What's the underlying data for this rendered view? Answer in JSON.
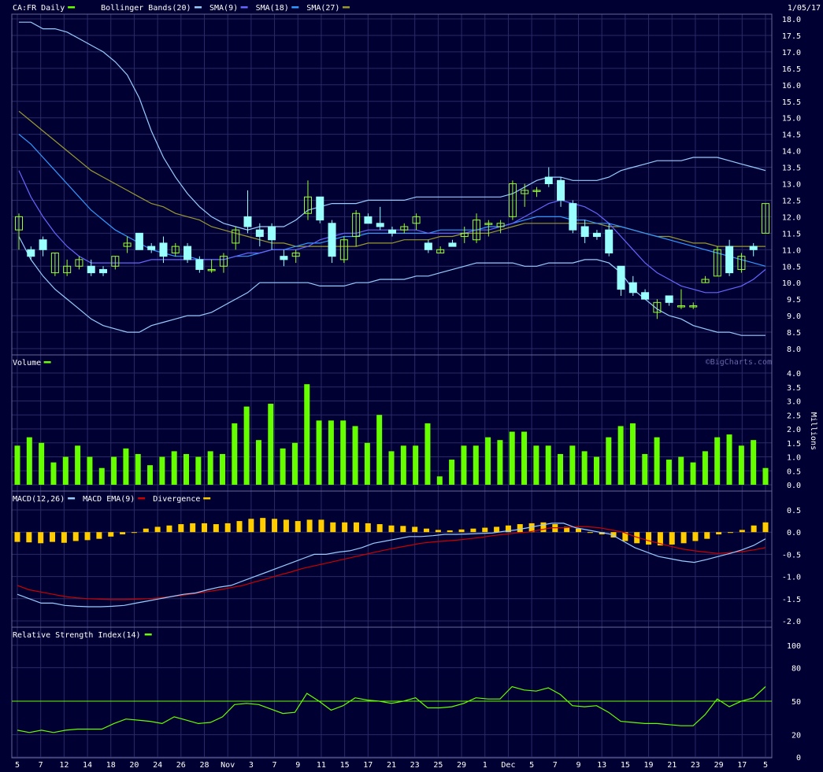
{
  "header": {
    "symbol_label": "CA:FR Daily",
    "date": "1/05/17",
    "watermark": "©BigCharts.com"
  },
  "colors": {
    "background": "#000033",
    "grid": "#2a2a66",
    "candle_up": "#99ff33",
    "candle_down": "#99ffff",
    "bollinger": "#99ccff",
    "sma9": "#6666ff",
    "sma18": "#3399ff",
    "sma27": "#999933",
    "volume": "#66ff00",
    "macd": "#99ccff",
    "macd_ema": "#cc0000",
    "divergence": "#ffcc00",
    "rsi": "#66ff00",
    "rsi_line": "#66ff00"
  },
  "legends": {
    "price": [
      {
        "label": "CA:FR Daily",
        "color": "#66ff00"
      },
      {
        "label": "Bollinger Bands(20)",
        "color": "#99ccff"
      },
      {
        "label": "SMA(9)",
        "color": "#6666ff"
      },
      {
        "label": "SMA(18)",
        "color": "#3399ff"
      },
      {
        "label": "SMA(27)",
        "color": "#999933"
      }
    ],
    "volume": [
      {
        "label": "Volume",
        "color": "#66ff00"
      }
    ],
    "macd": [
      {
        "label": "MACD(12,26)",
        "color": "#99ccff"
      },
      {
        "label": "MACD EMA(9)",
        "color": "#cc0000"
      },
      {
        "label": "Divergence",
        "color": "#ffcc00"
      }
    ],
    "rsi": [
      {
        "label": "Relative Strength Index(14)",
        "color": "#66ff00"
      }
    ]
  },
  "x_axis_labels": [
    "5",
    "7",
    "12",
    "14",
    "18",
    "20",
    "24",
    "26",
    "28",
    "Nov",
    "3",
    "7",
    "9",
    "11",
    "15",
    "17",
    "21",
    "23",
    "25",
    "29",
    "1",
    "Dec",
    "5",
    "7",
    "9",
    "13",
    "15",
    "19",
    "21",
    "23",
    "29",
    "17",
    "5"
  ],
  "chart_data": [
    {
      "type": "candlestick",
      "panel": "price",
      "ylim": [
        8.0,
        18.0
      ],
      "y_ticks": [
        "8.0",
        "8.5",
        "9.0",
        "9.5",
        "10.0",
        "10.5",
        "11.0",
        "11.5",
        "12.0",
        "12.5",
        "13.0",
        "13.5",
        "14.0",
        "14.5",
        "15.0",
        "15.5",
        "16.0",
        "16.5",
        "17.0",
        "17.5",
        "18.0"
      ],
      "candles": [
        {
          "o": 11.6,
          "h": 12.1,
          "l": 11.0,
          "c": 12.0
        },
        {
          "o": 11.0,
          "h": 11.1,
          "l": 10.7,
          "c": 10.8
        },
        {
          "o": 11.3,
          "h": 11.4,
          "l": 10.8,
          "c": 11.0
        },
        {
          "o": 10.3,
          "h": 10.9,
          "l": 10.2,
          "c": 10.9
        },
        {
          "o": 10.3,
          "h": 10.7,
          "l": 10.2,
          "c": 10.5
        },
        {
          "o": 10.5,
          "h": 10.8,
          "l": 10.4,
          "c": 10.7
        },
        {
          "o": 10.5,
          "h": 10.7,
          "l": 10.2,
          "c": 10.3
        },
        {
          "o": 10.4,
          "h": 10.5,
          "l": 10.2,
          "c": 10.3
        },
        {
          "o": 10.5,
          "h": 10.8,
          "l": 10.4,
          "c": 10.8
        },
        {
          "o": 11.1,
          "h": 11.4,
          "l": 10.9,
          "c": 11.2
        },
        {
          "o": 11.5,
          "h": 11.5,
          "l": 11.0,
          "c": 11.0
        },
        {
          "o": 11.1,
          "h": 11.2,
          "l": 10.9,
          "c": 11.0
        },
        {
          "o": 11.2,
          "h": 11.4,
          "l": 10.6,
          "c": 10.8
        },
        {
          "o": 10.9,
          "h": 11.2,
          "l": 10.8,
          "c": 11.1
        },
        {
          "o": 11.1,
          "h": 11.2,
          "l": 10.6,
          "c": 10.7
        },
        {
          "o": 10.7,
          "h": 10.8,
          "l": 10.3,
          "c": 10.4
        },
        {
          "o": 10.4,
          "h": 10.7,
          "l": 10.3,
          "c": 10.4
        },
        {
          "o": 10.5,
          "h": 10.9,
          "l": 10.3,
          "c": 10.8
        },
        {
          "o": 11.2,
          "h": 11.7,
          "l": 11.0,
          "c": 11.6
        },
        {
          "o": 12.0,
          "h": 12.8,
          "l": 11.5,
          "c": 11.7
        },
        {
          "o": 11.6,
          "h": 11.8,
          "l": 11.1,
          "c": 11.4
        },
        {
          "o": 11.7,
          "h": 11.8,
          "l": 11.0,
          "c": 11.3
        },
        {
          "o": 10.8,
          "h": 11.0,
          "l": 10.5,
          "c": 10.7
        },
        {
          "o": 10.8,
          "h": 11.0,
          "l": 10.6,
          "c": 10.9
        },
        {
          "o": 12.1,
          "h": 13.1,
          "l": 11.9,
          "c": 12.6
        },
        {
          "o": 12.6,
          "h": 12.6,
          "l": 11.8,
          "c": 11.9
        },
        {
          "o": 11.8,
          "h": 11.9,
          "l": 10.6,
          "c": 10.8
        },
        {
          "o": 10.7,
          "h": 11.4,
          "l": 10.6,
          "c": 11.3
        },
        {
          "o": 11.4,
          "h": 12.2,
          "l": 11.1,
          "c": 12.1
        },
        {
          "o": 12.0,
          "h": 12.1,
          "l": 11.8,
          "c": 11.8
        },
        {
          "o": 11.8,
          "h": 12.3,
          "l": 11.6,
          "c": 11.7
        },
        {
          "o": 11.6,
          "h": 11.7,
          "l": 11.4,
          "c": 11.5
        },
        {
          "o": 11.6,
          "h": 11.8,
          "l": 11.5,
          "c": 11.7
        },
        {
          "o": 11.8,
          "h": 12.1,
          "l": 11.6,
          "c": 12.0
        },
        {
          "o": 11.2,
          "h": 11.3,
          "l": 10.9,
          "c": 11.0
        },
        {
          "o": 10.9,
          "h": 11.1,
          "l": 10.9,
          "c": 11.0
        },
        {
          "o": 11.2,
          "h": 11.3,
          "l": 11.1,
          "c": 11.1
        },
        {
          "o": 11.4,
          "h": 11.7,
          "l": 11.2,
          "c": 11.5
        },
        {
          "o": 11.3,
          "h": 12.1,
          "l": 11.2,
          "c": 11.9
        },
        {
          "o": 11.8,
          "h": 11.9,
          "l": 11.4,
          "c": 11.8
        },
        {
          "o": 11.7,
          "h": 11.9,
          "l": 11.5,
          "c": 11.8
        },
        {
          "o": 12.0,
          "h": 13.1,
          "l": 11.9,
          "c": 13.0
        },
        {
          "o": 12.7,
          "h": 13.0,
          "l": 12.3,
          "c": 12.8
        },
        {
          "o": 12.8,
          "h": 12.9,
          "l": 12.6,
          "c": 12.8
        },
        {
          "o": 13.2,
          "h": 13.5,
          "l": 12.9,
          "c": 13.0
        },
        {
          "o": 13.1,
          "h": 13.2,
          "l": 12.3,
          "c": 12.5
        },
        {
          "o": 12.4,
          "h": 12.5,
          "l": 11.5,
          "c": 11.6
        },
        {
          "o": 11.7,
          "h": 11.9,
          "l": 11.2,
          "c": 11.4
        },
        {
          "o": 11.5,
          "h": 11.6,
          "l": 11.3,
          "c": 11.4
        },
        {
          "o": 11.6,
          "h": 11.8,
          "l": 10.8,
          "c": 10.9
        },
        {
          "o": 10.5,
          "h": 10.5,
          "l": 9.6,
          "c": 9.8
        },
        {
          "o": 10.0,
          "h": 10.2,
          "l": 9.6,
          "c": 9.7
        },
        {
          "o": 9.7,
          "h": 9.8,
          "l": 9.5,
          "c": 9.5
        },
        {
          "o": 9.1,
          "h": 9.5,
          "l": 8.9,
          "c": 9.4
        },
        {
          "o": 9.6,
          "h": 9.6,
          "l": 9.3,
          "c": 9.4
        },
        {
          "o": 9.3,
          "h": 9.8,
          "l": 9.2,
          "c": 9.3
        },
        {
          "o": 9.3,
          "h": 9.4,
          "l": 9.2,
          "c": 9.3
        },
        {
          "o": 10.0,
          "h": 10.2,
          "l": 10.0,
          "c": 10.1
        },
        {
          "o": 10.2,
          "h": 11.1,
          "l": 10.2,
          "c": 11.0
        },
        {
          "o": 11.1,
          "h": 11.3,
          "l": 10.2,
          "c": 10.3
        },
        {
          "o": 10.4,
          "h": 10.9,
          "l": 10.3,
          "c": 10.8
        },
        {
          "o": 11.1,
          "h": 11.2,
          "l": 10.8,
          "c": 11.0
        },
        {
          "o": 11.5,
          "h": 12.4,
          "l": 11.5,
          "c": 12.4
        }
      ],
      "bollinger_upper": [
        17.9,
        17.9,
        17.7,
        17.7,
        17.6,
        17.4,
        17.2,
        17.0,
        16.7,
        16.3,
        15.6,
        14.6,
        13.8,
        13.2,
        12.7,
        12.3,
        12.0,
        11.8,
        11.7,
        11.6,
        11.7,
        11.7,
        11.7,
        11.9,
        12.2,
        12.3,
        12.4,
        12.4,
        12.4,
        12.5,
        12.5,
        12.5,
        12.5,
        12.6,
        12.6,
        12.6,
        12.6,
        12.6,
        12.6,
        12.6,
        12.6,
        12.7,
        12.9,
        13.1,
        13.2,
        13.2,
        13.1,
        13.1,
        13.1,
        13.2,
        13.4,
        13.5,
        13.6,
        13.7,
        13.7,
        13.7,
        13.8,
        13.8,
        13.8,
        13.7,
        13.6,
        13.5,
        13.4
      ],
      "bollinger_lower": [
        11.4,
        10.7,
        10.2,
        9.8,
        9.5,
        9.2,
        8.9,
        8.7,
        8.6,
        8.5,
        8.5,
        8.7,
        8.8,
        8.9,
        9.0,
        9.0,
        9.1,
        9.3,
        9.5,
        9.7,
        10.0,
        10.0,
        10.0,
        10.0,
        10.0,
        9.9,
        9.9,
        9.9,
        10.0,
        10.0,
        10.1,
        10.1,
        10.1,
        10.2,
        10.2,
        10.3,
        10.4,
        10.5,
        10.6,
        10.6,
        10.6,
        10.6,
        10.5,
        10.5,
        10.6,
        10.6,
        10.6,
        10.7,
        10.7,
        10.6,
        10.3,
        9.8,
        9.5,
        9.2,
        9.0,
        8.9,
        8.7,
        8.6,
        8.5,
        8.5,
        8.4,
        8.4,
        8.4
      ],
      "sma9": [
        13.4,
        12.6,
        12.0,
        11.5,
        11.1,
        10.8,
        10.6,
        10.6,
        10.6,
        10.6,
        10.6,
        10.7,
        10.7,
        10.7,
        10.7,
        10.7,
        10.7,
        10.7,
        10.8,
        10.9,
        10.9,
        11.0,
        11.0,
        11.0,
        11.1,
        11.3,
        11.4,
        11.5,
        11.5,
        11.6,
        11.6,
        11.6,
        11.6,
        11.6,
        11.5,
        11.5,
        11.5,
        11.5,
        11.6,
        11.6,
        11.7,
        11.8,
        12.0,
        12.2,
        12.4,
        12.5,
        12.4,
        12.3,
        12.1,
        11.8,
        11.4,
        11.0,
        10.6,
        10.3,
        10.1,
        9.9,
        9.8,
        9.7,
        9.7,
        9.8,
        9.9,
        10.1,
        10.4
      ],
      "sma18": [
        14.5,
        14.2,
        13.8,
        13.4,
        13.0,
        12.6,
        12.2,
        11.9,
        11.6,
        11.4,
        11.2,
        11.0,
        10.9,
        10.8,
        10.8,
        10.7,
        10.7,
        10.7,
        10.8,
        10.8,
        10.9,
        11.0,
        11.0,
        11.1,
        11.2,
        11.2,
        11.3,
        11.4,
        11.4,
        11.5,
        11.5,
        11.5,
        11.5,
        11.5,
        11.5,
        11.6,
        11.6,
        11.6,
        11.6,
        11.7,
        11.7,
        11.8,
        11.9,
        12.0,
        12.0,
        12.0,
        11.9,
        11.9,
        11.8,
        11.8,
        11.7,
        11.6,
        11.5,
        11.4,
        11.3,
        11.2,
        11.1,
        11.0,
        10.9,
        10.8,
        10.7,
        10.6,
        10.5
      ],
      "sma27": [
        15.2,
        14.9,
        14.6,
        14.3,
        14.0,
        13.7,
        13.4,
        13.2,
        13.0,
        12.8,
        12.6,
        12.4,
        12.3,
        12.1,
        12.0,
        11.9,
        11.7,
        11.6,
        11.5,
        11.4,
        11.3,
        11.2,
        11.2,
        11.1,
        11.1,
        11.1,
        11.1,
        11.1,
        11.1,
        11.2,
        11.2,
        11.2,
        11.3,
        11.3,
        11.3,
        11.4,
        11.4,
        11.5,
        11.5,
        11.5,
        11.6,
        11.7,
        11.8,
        11.8,
        11.8,
        11.8,
        11.8,
        11.8,
        11.8,
        11.7,
        11.7,
        11.6,
        11.5,
        11.4,
        11.4,
        11.3,
        11.2,
        11.2,
        11.1,
        11.1,
        11.1,
        11.1,
        11.1
      ]
    },
    {
      "type": "bar",
      "panel": "volume",
      "ylabel": "Millions",
      "ylim": [
        0,
        4.0
      ],
      "y_ticks": [
        "0.0",
        "0.5",
        "1.0",
        "1.5",
        "2.0",
        "2.5",
        "3.0",
        "3.5",
        "4.0"
      ],
      "values": [
        1.4,
        1.7,
        1.5,
        0.8,
        1.0,
        1.4,
        1.0,
        0.6,
        1.0,
        1.3,
        1.1,
        0.7,
        1.0,
        1.2,
        1.1,
        1.0,
        1.2,
        1.1,
        2.2,
        2.8,
        1.6,
        2.9,
        1.3,
        1.5,
        3.6,
        2.3,
        2.3,
        2.3,
        2.1,
        1.5,
        2.5,
        1.2,
        1.4,
        1.4,
        2.2,
        0.3,
        0.9,
        1.4,
        1.4,
        1.7,
        1.6,
        1.9,
        1.9,
        1.4,
        1.4,
        1.1,
        1.4,
        1.2,
        1.0,
        1.7,
        2.1,
        2.2,
        1.1,
        1.7,
        0.9,
        1.0,
        0.8,
        1.2,
        1.7,
        1.8,
        1.4,
        1.6,
        0.6
      ]
    },
    {
      "type": "line",
      "panel": "macd",
      "ylim": [
        -2.0,
        0.5
      ],
      "y_ticks": [
        "0.5",
        "0.0",
        "-0.5",
        "-1.0",
        "-1.5",
        "-2.0"
      ],
      "macd": [
        -1.4,
        -1.5,
        -1.6,
        -1.6,
        -1.65,
        -1.67,
        -1.68,
        -1.68,
        -1.67,
        -1.65,
        -1.6,
        -1.55,
        -1.5,
        -1.45,
        -1.4,
        -1.37,
        -1.3,
        -1.24,
        -1.2,
        -1.1,
        -1.0,
        -0.9,
        -0.8,
        -0.7,
        -0.6,
        -0.5,
        -0.5,
        -0.45,
        -0.42,
        -0.35,
        -0.25,
        -0.2,
        -0.15,
        -0.1,
        -0.1,
        -0.08,
        -0.05,
        -0.05,
        -0.04,
        -0.03,
        -0.02,
        0.02,
        0.05,
        0.1,
        0.15,
        0.2,
        0.2,
        0.1,
        0.05,
        0.0,
        -0.05,
        -0.2,
        -0.35,
        -0.45,
        -0.55,
        -0.6,
        -0.65,
        -0.68,
        -0.62,
        -0.55,
        -0.48,
        -0.4,
        -0.3,
        -0.15
      ],
      "macd_ema": [
        -1.2,
        -1.3,
        -1.35,
        -1.4,
        -1.45,
        -1.48,
        -1.5,
        -1.51,
        -1.52,
        -1.52,
        -1.51,
        -1.5,
        -1.48,
        -1.45,
        -1.42,
        -1.38,
        -1.34,
        -1.3,
        -1.25,
        -1.2,
        -1.12,
        -1.05,
        -0.97,
        -0.9,
        -0.82,
        -0.76,
        -0.7,
        -0.64,
        -0.58,
        -0.52,
        -0.46,
        -0.4,
        -0.35,
        -0.3,
        -0.25,
        -0.22,
        -0.2,
        -0.18,
        -0.15,
        -0.12,
        -0.08,
        -0.05,
        -0.02,
        0.0,
        0.05,
        0.1,
        0.1,
        0.12,
        0.12,
        0.1,
        0.05,
        0.0,
        -0.1,
        -0.18,
        -0.25,
        -0.32,
        -0.38,
        -0.42,
        -0.45,
        -0.48,
        -0.46,
        -0.44,
        -0.4,
        -0.35
      ],
      "divergence": [
        -0.22,
        -0.23,
        -0.25,
        -0.22,
        -0.24,
        -0.2,
        -0.18,
        -0.15,
        -0.1,
        -0.05,
        0.0,
        0.08,
        0.12,
        0.15,
        0.18,
        0.2,
        0.2,
        0.18,
        0.2,
        0.25,
        0.3,
        0.32,
        0.3,
        0.28,
        0.25,
        0.28,
        0.28,
        0.22,
        0.22,
        0.22,
        0.2,
        0.18,
        0.15,
        0.14,
        0.12,
        0.08,
        0.05,
        0.04,
        0.06,
        0.08,
        0.1,
        0.12,
        0.15,
        0.18,
        0.2,
        0.22,
        0.18,
        0.12,
        0.08,
        0.0,
        -0.05,
        -0.12,
        -0.2,
        -0.25,
        -0.28,
        -0.3,
        -0.28,
        -0.25,
        -0.2,
        -0.15,
        -0.05,
        0.0,
        0.05,
        0.15,
        0.22
      ]
    },
    {
      "type": "line",
      "panel": "rsi",
      "ylim": [
        0,
        100
      ],
      "y_ticks": [
        "100",
        "80",
        "50",
        "20",
        "0"
      ],
      "reference_line": 50,
      "values": [
        24,
        22,
        24,
        22,
        24,
        25,
        25,
        25,
        30,
        34,
        33,
        32,
        30,
        36,
        33,
        30,
        31,
        36,
        47,
        48,
        47,
        43,
        39,
        40,
        57,
        50,
        42,
        46,
        53,
        51,
        50,
        48,
        50,
        53,
        44,
        44,
        45,
        48,
        53,
        52,
        52,
        63,
        60,
        59,
        62,
        56,
        46,
        45,
        46,
        40,
        32,
        31,
        30,
        30,
        29,
        28,
        28,
        38,
        52,
        45,
        50,
        53,
        63
      ]
    }
  ]
}
